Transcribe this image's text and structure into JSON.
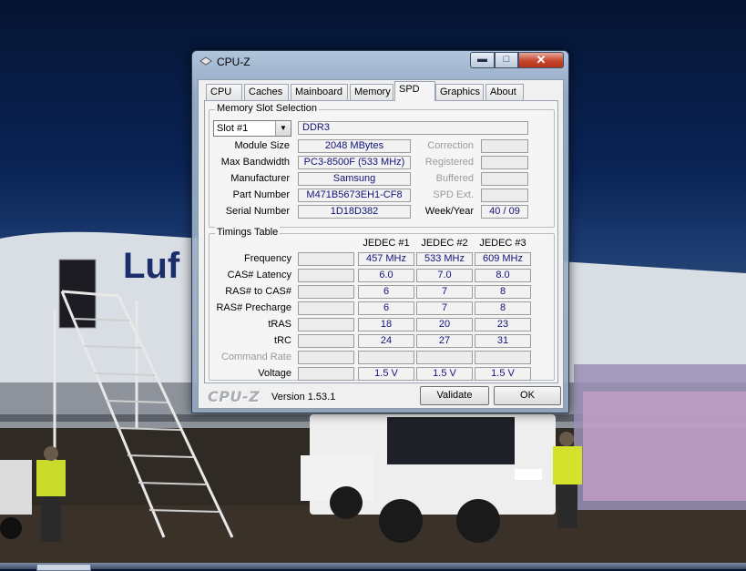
{
  "window": {
    "title": "CPU-Z",
    "controls": {
      "minimize": "▬",
      "maximize": "□",
      "close": "✕"
    }
  },
  "tabs": [
    {
      "label": "CPU",
      "active": false
    },
    {
      "label": "Caches",
      "active": false
    },
    {
      "label": "Mainboard",
      "active": false
    },
    {
      "label": "Memory",
      "active": false
    },
    {
      "label": "SPD",
      "active": true
    },
    {
      "label": "Graphics",
      "active": false
    },
    {
      "label": "About",
      "active": false
    }
  ],
  "memory_slot": {
    "group_title": "Memory Slot Selection",
    "slot_selected": "Slot #1",
    "type": "DDR3",
    "module_size_label": "Module Size",
    "module_size": "2048 MBytes",
    "max_bandwidth_label": "Max Bandwidth",
    "max_bandwidth": "PC3-8500F (533 MHz)",
    "manufacturer_label": "Manufacturer",
    "manufacturer": "Samsung",
    "part_number_label": "Part Number",
    "part_number": "M471B5673EH1-CF8",
    "serial_number_label": "Serial Number",
    "serial_number": "1D18D382",
    "correction_label": "Correction",
    "correction": "",
    "registered_label": "Registered",
    "registered": "",
    "buffered_label": "Buffered",
    "buffered": "",
    "spd_ext_label": "SPD Ext.",
    "spd_ext": "",
    "week_year_label": "Week/Year",
    "week_year": "40 / 09"
  },
  "timings": {
    "group_title": "Timings Table",
    "columns": [
      "JEDEC #1",
      "JEDEC #2",
      "JEDEC #3"
    ],
    "rows": [
      {
        "label": "Frequency",
        "values": [
          "457 MHz",
          "533 MHz",
          "609 MHz"
        ],
        "disabled": false
      },
      {
        "label": "CAS# Latency",
        "values": [
          "6.0",
          "7.0",
          "8.0"
        ],
        "disabled": false
      },
      {
        "label": "RAS# to CAS#",
        "values": [
          "6",
          "7",
          "8"
        ],
        "disabled": false
      },
      {
        "label": "RAS# Precharge",
        "values": [
          "6",
          "7",
          "8"
        ],
        "disabled": false
      },
      {
        "label": "tRAS",
        "values": [
          "18",
          "20",
          "23"
        ],
        "disabled": false
      },
      {
        "label": "tRC",
        "values": [
          "24",
          "27",
          "31"
        ],
        "disabled": false
      },
      {
        "label": "Command Rate",
        "values": [
          "",
          "",
          ""
        ],
        "disabled": true
      },
      {
        "label": "Voltage",
        "values": [
          "1.5 V",
          "1.5 V",
          "1.5 V"
        ],
        "disabled": false
      }
    ]
  },
  "footer": {
    "brand": "CPU-Z",
    "version": "Version 1.53.1",
    "validate_label": "Validate",
    "ok_label": "OK"
  }
}
